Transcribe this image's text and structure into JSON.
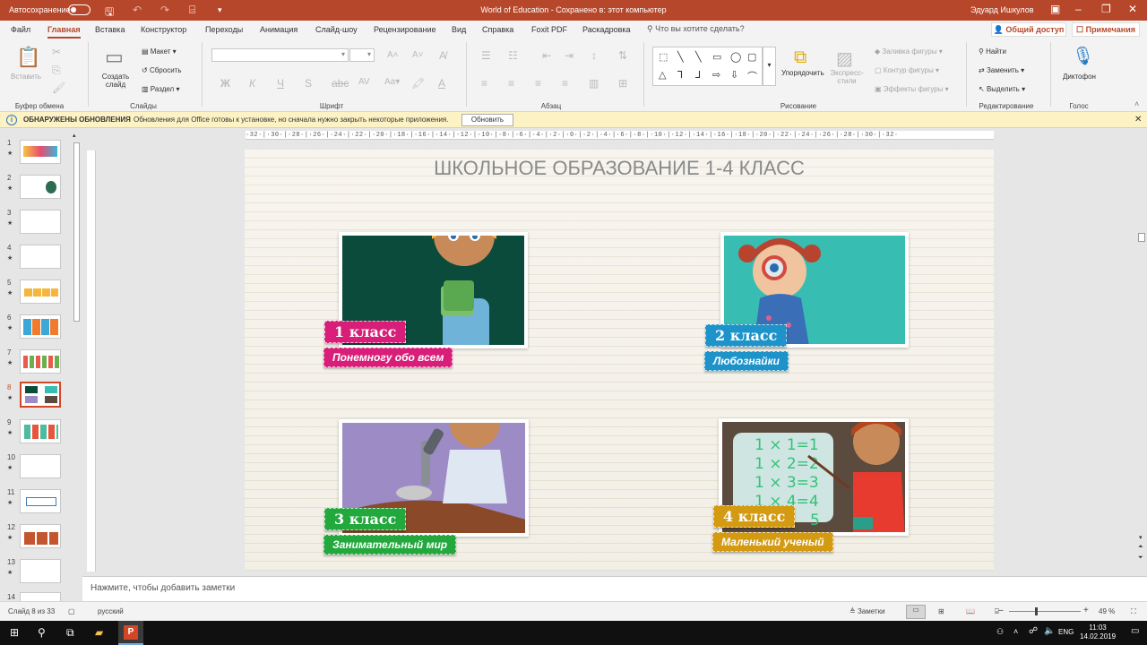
{
  "titlebar": {
    "autosave": "Автосохранение",
    "doc_title": "World of Education  -  Сохранено в: этот компьютер",
    "user": "Эдуард Ишкулов",
    "accent": "#b7472a"
  },
  "tabs": [
    "Файл",
    "Главная",
    "Вставка",
    "Конструктор",
    "Переходы",
    "Анимация",
    "Слайд-шоу",
    "Рецензирование",
    "Вид",
    "Справка",
    "Foxit PDF",
    "Раскадровка"
  ],
  "tellme": "Что вы хотите сделать?",
  "share": "Общий доступ",
  "comments": "Примечания",
  "ribbon": {
    "paste": "Вставить",
    "create_slide": "Создать слайд",
    "layout": "Макет",
    "reset": "Сбросить",
    "section": "Раздел",
    "arrange": "Упорядочить",
    "quick_styles": "Экспресс-стили",
    "shape_fill": "Заливка фигуры",
    "shape_outline": "Контур фигуры",
    "shape_effects": "Эффекты фигуры",
    "find": "Найти",
    "replace": "Заменить",
    "select": "Выделить",
    "dictate": "Диктофон",
    "groups": {
      "clipboard": "Буфер обмена",
      "slides": "Слайды",
      "font": "Шрифт",
      "paragraph": "Абзац",
      "drawing": "Рисование",
      "editing": "Редактирование",
      "voice": "Голос"
    }
  },
  "notification": {
    "head": "ОБНАРУЖЕНЫ ОБНОВЛЕНИЯ",
    "message": "Обновления для Office готовы к установке, но сначала нужно закрыть некоторые приложения.",
    "button": "Обновить"
  },
  "ruler_text": "·32·|·30·|·28·|·26·|·24·|·22·|·20·|·18·|·16·|·14·|·12·|·10·|·8·|·6·|·4·|·2·|·0·|·2·|·4·|·6·|·8·|·10·|·12·|·14·|·16·|·18·|·20·|·22·|·24·|·26·|·28·|·30·|·32·",
  "thumbnails": [
    "1",
    "2",
    "3",
    "4",
    "5",
    "6",
    "7",
    "8",
    "9",
    "10",
    "11",
    "12",
    "13",
    "14"
  ],
  "slide": {
    "title": "ШКОЛЬНОЕ ОБРАЗОВАНИЕ 1-4 КЛАСС",
    "cards": [
      {
        "grade": "1 класс",
        "subtitle": "Понемногу обо всем",
        "bg": "#0a4b3b",
        "color": "#d81e79"
      },
      {
        "grade": "2 класс",
        "subtitle": "Любознайки",
        "bg": "#37bdb2",
        "color": "#1d93c9"
      },
      {
        "grade": "3 класс",
        "subtitle": "Занимательный мир",
        "bg": "#9d8bc6",
        "color": "#22a83d"
      },
      {
        "grade": "4 класс",
        "subtitle": "Маленький ученый",
        "bg": "#5b4a3e",
        "color": "#d39a12"
      }
    ],
    "board_formulas": [
      "1 × 1=1",
      "1 × 2=2",
      "1 × 3=3",
      "1 × 4=4",
      "5"
    ]
  },
  "notes_placeholder": "Нажмите, чтобы добавить заметки",
  "status": {
    "slide_counter": "Слайд 8 из 33",
    "language": "русский",
    "notes": "Заметки",
    "zoom": "49 %"
  },
  "taskbar": {
    "lang": "ENG",
    "time": "11:03",
    "date": "14.02.2019"
  }
}
